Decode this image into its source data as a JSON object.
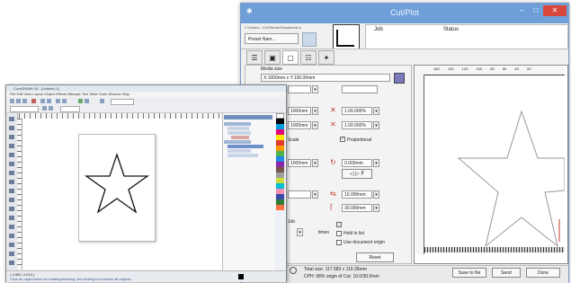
{
  "cutplot": {
    "title": "Cut/Plot",
    "path": "C:\\Users\\...\\CutStudio\\Samples\\st.s",
    "preset_label": "Preset Nam...",
    "job_header": "Job",
    "status_header": "Status",
    "media_size_label": "Media size",
    "media_size_value": "X:1000mm x Y:100.00mm",
    "size_x": "1000mm",
    "size_y": "1000mm",
    "pct1": "1.00.000%",
    "pct2": "1.00.000%",
    "scale_label": "Scale",
    "proportional_label": "Proportional",
    "offset": "0.000mm",
    "origin_x": "10.000mm",
    "origin_y": "30.000mm",
    "copies_label": "Job",
    "times_label": "times",
    "hold_label": "Hold in list",
    "use_doc_label": "Use document origin",
    "reset_label": "Reset",
    "status_line1": "Total size: 117.583 x 119.35mm",
    "status_line2": "CPH: 98% origin of Cut: 10.0/30.0mm",
    "save_to_file": "Save to file",
    "send": "Send",
    "done": "Done",
    "ruler_ticks": [
      "160",
      "140",
      "120",
      "100",
      "80",
      "60",
      "40",
      "20"
    ],
    "minimize": "–",
    "maximize": "□",
    "close": "✕",
    "logo": "✱",
    "tab_icons": [
      "☰",
      "▣",
      "▢",
      "☷",
      "✦"
    ],
    "arrow_icons": "◁ ▷ F",
    "flip_icon": "⇆",
    "check_mark": "✓"
  },
  "corel": {
    "title": "CorelDRAW X6 - [Untitled-1]",
    "menu": "File  Edit  View  Layout  Object  Effects  Bitmaps  Text  Table  Tools  Window  Help",
    "docker_title": "Object Manager",
    "status_text": "Click an object twice for rotating/skewing; dbl-clicking tool selects all objects...",
    "coords": "( 4.952, 4.213 )"
  },
  "colors": {
    "cut_titlebar": "#6f9fd8",
    "close_red": "#d9473a",
    "accent_red": "#c0392b",
    "preview_star": "#999999",
    "corel_star": "#111111"
  }
}
